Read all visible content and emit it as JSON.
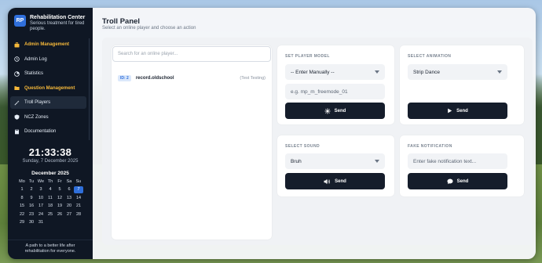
{
  "brand": {
    "logo": "RP",
    "title": "Rehabilitation Center",
    "subtitle": "Serious treatment for tired people."
  },
  "nav": [
    {
      "label": "Admin Management",
      "icon": "briefcase-icon",
      "accent": true
    },
    {
      "label": "Admin Log",
      "icon": "history-icon"
    },
    {
      "label": "Statistics",
      "icon": "chart-icon"
    },
    {
      "label": "Question Management",
      "icon": "folder-icon",
      "accent": true
    },
    {
      "label": "Troll Players",
      "icon": "wand-icon",
      "active": true
    },
    {
      "label": "NCZ Zones",
      "icon": "zone-icon"
    },
    {
      "label": "Documentation",
      "icon": "book-icon"
    }
  ],
  "clock": {
    "time": "21:33:38",
    "date": "Sunday, 7 December 2025"
  },
  "calendar": {
    "title": "December 2025",
    "weekdays": [
      "Mo",
      "Tu",
      "We",
      "Th",
      "Fr",
      "Sa",
      "Su"
    ],
    "days": [
      "1",
      "2",
      "3",
      "4",
      "5",
      "6",
      "7",
      "8",
      "9",
      "10",
      "11",
      "12",
      "13",
      "14",
      "15",
      "16",
      "17",
      "18",
      "19",
      "20",
      "21",
      "22",
      "23",
      "24",
      "25",
      "26",
      "27",
      "28",
      "29",
      "30",
      "31"
    ],
    "today": "7"
  },
  "footer": "A path to a better life after rehabilitation for everyone.",
  "page": {
    "title": "Troll Panel",
    "subtitle": "Select an online player and choose an action"
  },
  "players": {
    "search_placeholder": "Search for an online player...",
    "list": [
      {
        "id": "ID: 2",
        "name": "record.oldschool",
        "tag": "(Test Testing)"
      }
    ]
  },
  "cards": {
    "model": {
      "title": "SET PLAYER MODEL",
      "select": "-- Enter Manually --",
      "input_placeholder": "e.g. mp_m_freemode_01",
      "button": "Send"
    },
    "animation": {
      "title": "SELECT ANIMATION",
      "select": "Strip Dance",
      "button": "Send"
    },
    "sound": {
      "title": "SELECT SOUND",
      "select": "Bruh",
      "button": "Send"
    },
    "notification": {
      "title": "FAKE NOTIFICATION",
      "input_placeholder": "Enter fake notification text...",
      "button": "Send"
    }
  },
  "colors": {
    "sidebar": "#0f1724",
    "accent": "#f5b83a",
    "primary": "#2f6fdb",
    "button": "#151d2b"
  }
}
